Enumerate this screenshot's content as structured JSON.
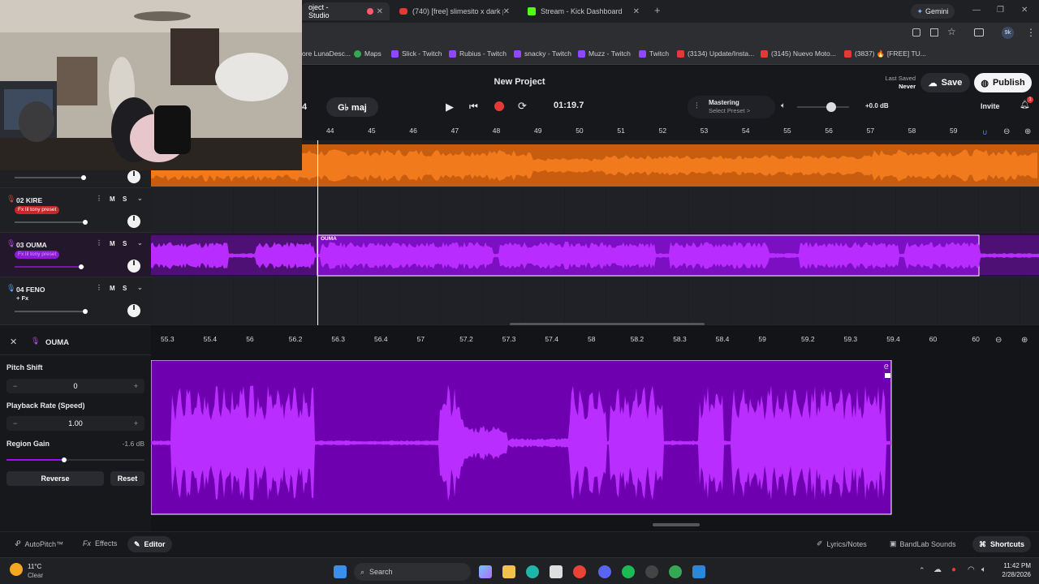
{
  "browser": {
    "tabs": [
      {
        "label": "oject - Studio",
        "active": true
      },
      {
        "label": "(740) [free] slimesito x dark plu",
        "active": false
      },
      {
        "label": "Stream - Kick Dashboard",
        "active": false
      }
    ],
    "new_tab": "+",
    "gemini_label": "Gemini",
    "profile_badge": "9k",
    "bookmarks": [
      "ore LunaDesc...",
      "Maps",
      "Slick - Twitch",
      "Rubius - Twitch",
      "snacky - Twitch",
      "Muzz - Twitch",
      "Twitch",
      "(3134) Update/Insta...",
      "(3145) Nuevo Moto...",
      "(3837) 🔥 [FREE] TU..."
    ]
  },
  "daw": {
    "project_title": "New Project",
    "last_saved_label": "Last Saved",
    "last_saved_value": "Never",
    "save_label": "Save",
    "publish_label": "Publish",
    "invite_label": "Invite",
    "key_label": "G♭ maj",
    "count_label": "4",
    "time": "01:19.7",
    "mastering_label": "Mastering",
    "mastering_sub": "Select Preset >",
    "volume_db": "+0.0 dB",
    "notif_count": "1",
    "ruler_ticks": [
      "44",
      "45",
      "46",
      "47",
      "48",
      "49",
      "50",
      "51",
      "52",
      "53",
      "54",
      "55",
      "56",
      "57",
      "58",
      "59"
    ],
    "tracks": [
      {
        "id": "01",
        "name": ""
      },
      {
        "id": "02",
        "name": "02  KIRE",
        "fx": "Fx lil tony preset"
      },
      {
        "id": "03",
        "name": "03  OUMA",
        "fx": "Fx lil tony preset",
        "clip": "OUMA"
      },
      {
        "id": "04",
        "name": "04  FENO",
        "fx": "+ Fx"
      }
    ],
    "m_label": "M",
    "s_label": "S"
  },
  "editor": {
    "track_name": "OUMA",
    "pitch_shift_label": "Pitch Shift",
    "pitch_shift_value": "0",
    "playback_rate_label": "Playback Rate (Speed)",
    "playback_rate_value": "1.00",
    "region_gain_label": "Region Gain",
    "region_gain_value": "-1.6 dB",
    "reverse_label": "Reverse",
    "reset_label": "Reset",
    "ruler_ticks": [
      "55.3",
      "55.4",
      "56",
      "56.2",
      "56.3",
      "56.4",
      "57",
      "57.2",
      "57.3",
      "57.4",
      "58",
      "58.2",
      "58.3",
      "58.4",
      "59",
      "59.2",
      "59.3",
      "59.4",
      "60",
      "60"
    ]
  },
  "bottom": {
    "autopitch": "AutoPitch™",
    "effects": "Effects",
    "editor": "Editor",
    "lyrics": "Lyrics/Notes",
    "sounds": "BandLab Sounds",
    "shortcuts": "Shortcuts"
  },
  "taskbar": {
    "weather_temp": "11°C",
    "weather_desc": "Clear",
    "search_label": "Search",
    "time": "11:42 PM",
    "date": "2/28/2026"
  },
  "colors": {
    "orange": "#f07a1c",
    "purple": "#9b10f2",
    "accent_red": "#e53935"
  }
}
